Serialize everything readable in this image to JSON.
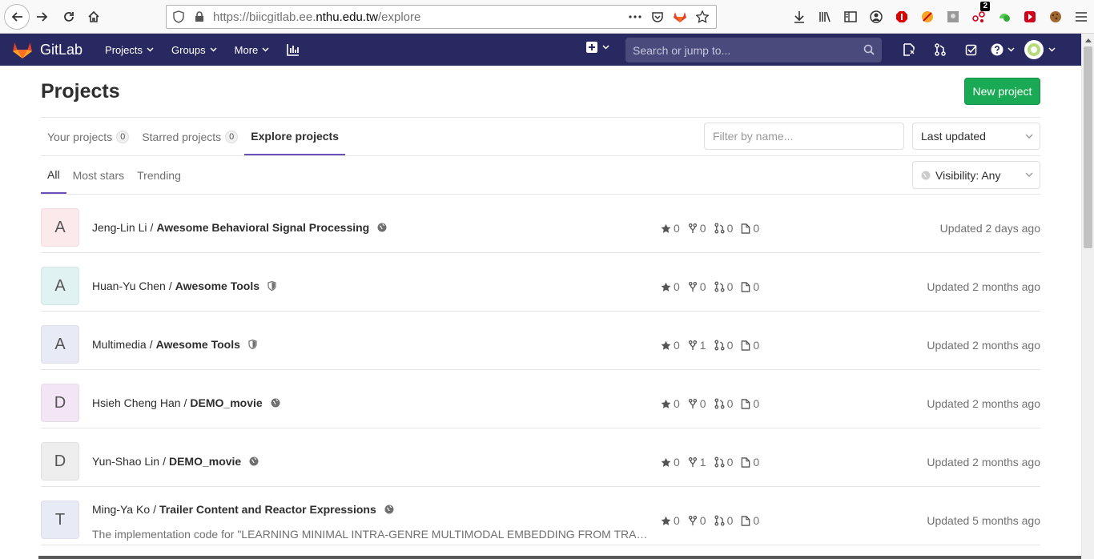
{
  "browser": {
    "url_prefix": "https://biicgitlab.ee.",
    "url_domain": "nthu.edu.tw",
    "url_path": "/explore",
    "badge_count": "2"
  },
  "navbar": {
    "brand": "GitLab",
    "menu": [
      {
        "label": "Projects"
      },
      {
        "label": "Groups"
      },
      {
        "label": "More"
      }
    ],
    "search_placeholder": "Search or jump to..."
  },
  "page": {
    "title": "Projects",
    "new_project_label": "New project"
  },
  "tabs": [
    {
      "label": "Your projects",
      "count": "0"
    },
    {
      "label": "Starred projects",
      "count": "0"
    },
    {
      "label": "Explore projects"
    }
  ],
  "filter_placeholder": "Filter by name...",
  "sort_label": "Last updated",
  "subtabs": [
    {
      "label": "All"
    },
    {
      "label": "Most stars"
    },
    {
      "label": "Trending"
    }
  ],
  "visibility_label": "Visibility: Any",
  "projects": [
    {
      "initial": "A",
      "namespace": "Jeng-Lin Li",
      "name": "Awesome Behavioral Signal Processing",
      "visibility": "public",
      "stars": "0",
      "forks": "0",
      "mrs": "0",
      "issues": "0",
      "updated": "Updated 2 days ago",
      "avatar_color": "#fbe9eb",
      "description": ""
    },
    {
      "initial": "A",
      "namespace": "Huan-Yu Chen",
      "name": "Awesome Tools",
      "visibility": "internal",
      "stars": "0",
      "forks": "0",
      "mrs": "0",
      "issues": "0",
      "updated": "Updated 2 months ago",
      "avatar_color": "#e0f2f1",
      "description": ""
    },
    {
      "initial": "A",
      "namespace": "Multimedia",
      "name": "Awesome Tools",
      "visibility": "internal",
      "stars": "0",
      "forks": "1",
      "mrs": "0",
      "issues": "0",
      "updated": "Updated 2 months ago",
      "avatar_color": "#e8eaf6",
      "description": ""
    },
    {
      "initial": "D",
      "namespace": "Hsieh Cheng Han",
      "name": "DEMO_movie",
      "visibility": "public",
      "stars": "0",
      "forks": "0",
      "mrs": "0",
      "issues": "0",
      "updated": "Updated 2 months ago",
      "avatar_color": "#f3e5f5",
      "description": ""
    },
    {
      "initial": "D",
      "namespace": "Yun-Shao Lin",
      "name": "DEMO_movie",
      "visibility": "public",
      "stars": "0",
      "forks": "1",
      "mrs": "0",
      "issues": "0",
      "updated": "Updated 2 months ago",
      "avatar_color": "#eeeeee",
      "description": ""
    },
    {
      "initial": "T",
      "namespace": "Ming-Ya Ko",
      "name": "Trailer Content and Reactor Expressions",
      "visibility": "public",
      "stars": "0",
      "forks": "0",
      "mrs": "0",
      "issues": "0",
      "updated": "Updated 5 months ago",
      "avatar_color": "#e8eaf6",
      "description": "The implementation code for \"LEARNING MINIMAL INTRA-GENRE MULTIMODAL EMBEDDING FROM TRAILER ..."
    }
  ]
}
